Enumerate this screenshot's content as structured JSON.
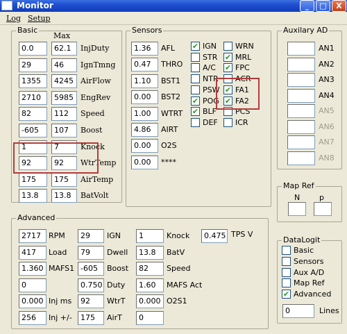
{
  "window": {
    "title": "Monitor",
    "minimize": "_",
    "maximize": "□",
    "close": "X"
  },
  "menu": {
    "log": "Log",
    "setup": "Setup"
  },
  "basic": {
    "title": "Basic",
    "max_header": "Max",
    "rows": [
      {
        "value": "0.0",
        "max": "62.1",
        "label": "InjDuty"
      },
      {
        "value": "29",
        "max": "46",
        "label": "IgnTmng"
      },
      {
        "value": "1355",
        "max": "4245",
        "label": "AirFlow"
      },
      {
        "value": "2710",
        "max": "5985",
        "label": "EngRev"
      },
      {
        "value": "82",
        "max": "112",
        "label": "Speed"
      },
      {
        "value": "-605",
        "max": "107",
        "label": "Boost"
      },
      {
        "value": "1",
        "max": "7",
        "label": "Knock"
      },
      {
        "value": "92",
        "max": "92",
        "label": "WtrTemp"
      },
      {
        "value": "175",
        "max": "175",
        "label": "AirTemp"
      },
      {
        "value": "13.8",
        "max": "13.8",
        "label": "BatVolt"
      }
    ]
  },
  "sensors": {
    "title": "Sensors",
    "rows": [
      {
        "value": "1.36",
        "label": "AFL"
      },
      {
        "value": "0.47",
        "label": "THRO"
      },
      {
        "value": "1.10",
        "label": "BST1"
      },
      {
        "value": "0.00",
        "label": "BST2"
      },
      {
        "value": "1.00",
        "label": "WTRT"
      },
      {
        "value": "4.86",
        "label": "AIRT"
      },
      {
        "value": "0.00",
        "label": "O2S"
      },
      {
        "value": "0.00",
        "label": "****"
      }
    ],
    "switches_col1": [
      {
        "label": "IGN",
        "checked": true
      },
      {
        "label": "STR",
        "checked": false
      },
      {
        "label": "A/C",
        "checked": false
      },
      {
        "label": "NTR",
        "checked": false
      },
      {
        "label": "PSW",
        "checked": false
      },
      {
        "label": "POG",
        "checked": true
      },
      {
        "label": "BLF",
        "checked": true
      },
      {
        "label": "DEF",
        "checked": false
      }
    ],
    "switches_col2": [
      {
        "label": "WRN",
        "checked": false
      },
      {
        "label": "MRL",
        "checked": true
      },
      {
        "label": "FPC",
        "checked": true
      },
      {
        "label": "ACR",
        "checked": false
      },
      {
        "label": "FA1",
        "checked": true
      },
      {
        "label": "FA2",
        "checked": true
      },
      {
        "label": "PCS",
        "checked": false
      },
      {
        "label": "ICR",
        "checked": false
      }
    ]
  },
  "auxiliary": {
    "title": "Auxilary AD",
    "items": [
      "AN1",
      "AN2",
      "AN3",
      "AN4",
      "AN5",
      "AN6",
      "AN7",
      "AN8"
    ]
  },
  "map_ref": {
    "title": "Map Ref",
    "n_label": "N",
    "p_label": "p",
    "n_value": "",
    "p_value": ""
  },
  "advanced": {
    "title": "Advanced",
    "rows": [
      {
        "value": "2717",
        "label": "RPM",
        "value2": "29",
        "label2": "IGN",
        "value3": "1",
        "label3": "Knock",
        "value4": "0.475",
        "label4": "TPS V"
      },
      {
        "value": "417",
        "label": "Load",
        "value2": "79",
        "label2": "Dwell",
        "value3": "13.8",
        "label3": "BatV"
      },
      {
        "value": "1.360",
        "label": "MAFS1",
        "value2": "-605",
        "label2": "Boost",
        "value3": "82",
        "label3": "Speed"
      },
      {
        "value": "0",
        "label": "",
        "value2": "0.750",
        "label2": "Duty",
        "value3": "1.60",
        "label3": "MAFS Act"
      },
      {
        "value": "0.000",
        "label": "Inj ms",
        "value2": "92",
        "label2": "WtrT",
        "value3": "0.000",
        "label3": "O2S1"
      },
      {
        "value": "256",
        "label": "Inj +/-",
        "value2": "175",
        "label2": "AirT",
        "value3": "0",
        "label3": ""
      }
    ]
  },
  "datalogit": {
    "title": "DataLogit",
    "options": [
      {
        "label": "Basic",
        "checked": false
      },
      {
        "label": "Sensors",
        "checked": false
      },
      {
        "label": "Aux A/D",
        "checked": false
      },
      {
        "label": "Map Ref",
        "checked": false
      },
      {
        "label": "Advanced",
        "checked": true
      }
    ],
    "lines_value": "0",
    "lines_label": "Lines"
  },
  "colors": {
    "highlight": "#b23c3c",
    "check": "#21a121"
  }
}
